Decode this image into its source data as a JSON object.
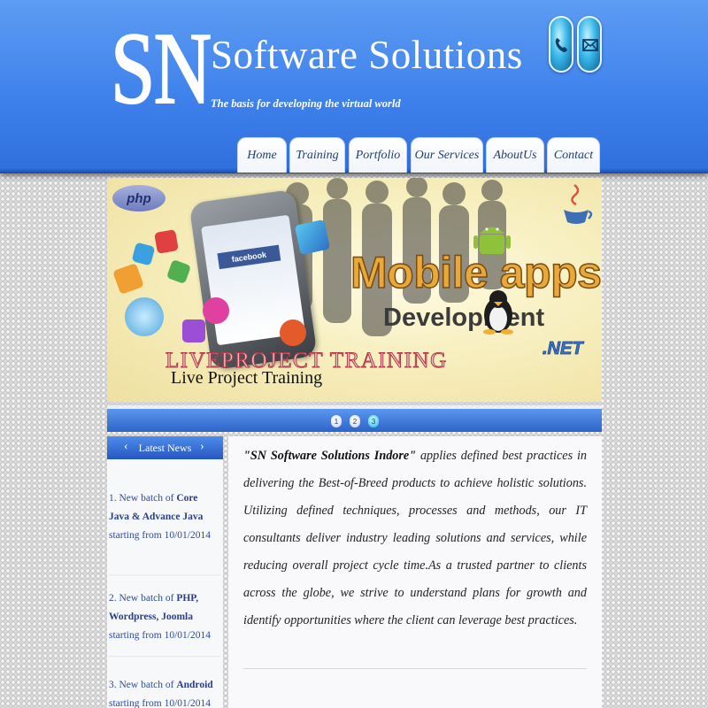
{
  "brand": {
    "logo_text": "SN",
    "name": "Software Solutions",
    "tagline": "The basis for developing the virtual world"
  },
  "header_icons": [
    "phone-icon",
    "mail-icon"
  ],
  "nav": {
    "items": [
      {
        "label": "Home"
      },
      {
        "label": "Training"
      },
      {
        "label": "Portfolio"
      },
      {
        "label": "Our Services"
      },
      {
        "label": "AboutUs"
      },
      {
        "label": "Contact"
      }
    ]
  },
  "banner": {
    "php_badge": "php",
    "headline": "Mobile apps",
    "subheadline": "Development",
    "net_badge": ".NET",
    "overlay_text": "LIVEPROJECT TRAINING",
    "caption": "Live Project Training",
    "phone_app_label": "facebook"
  },
  "slider": {
    "dots": [
      "1",
      "2",
      "3"
    ],
    "active_index": 3
  },
  "news": {
    "title": "Latest News",
    "prev_arrow": "‹",
    "next_arrow": "›",
    "items": [
      {
        "prefix": "1. New batch of ",
        "highlight": "Core Java & Advance Java",
        "suffix": " starting from 10/01/2014"
      },
      {
        "prefix": "2. New batch of ",
        "highlight": "PHP, Wordpress, Joomla",
        "suffix": " starting from 10/01/2014"
      },
      {
        "prefix": "3. New batch of ",
        "highlight": "Android",
        "suffix": " starting from 10/01/2014"
      }
    ]
  },
  "intro": {
    "company_quote": "\"SN Software Solutions Indore\"",
    "body": " applies defined best practices in delivering the Best-of-Breed products to achieve holistic solutions. Utilizing defined techniques, processes and methods, our IT consultants deliver industry leading solutions and services, while reducing overall project cycle time.As a trusted partner to clients across the globe, we strive to understand plans for growth and identify opportunities where the client can leverage best practices."
  },
  "colors": {
    "header_blue": "#3f82ec",
    "nav_text": "#1f3e76",
    "news_link": "#2d4b9a"
  }
}
